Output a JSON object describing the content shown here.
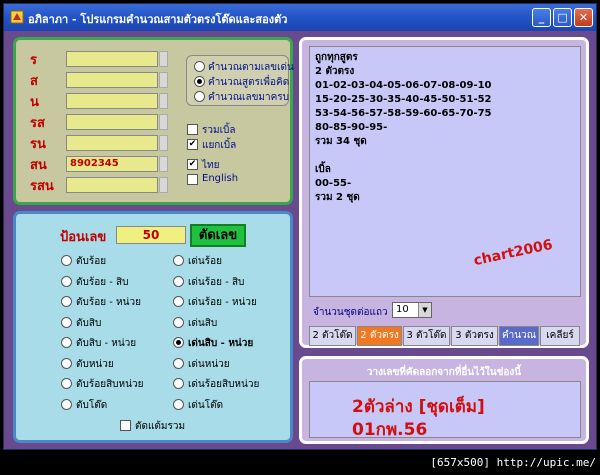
{
  "window": {
    "title": "อภิลาภา - โปรแกรมคำนวณสามตัวตรงโต๊ดและสองตัว"
  },
  "numbers": {
    "fields": [
      {
        "label": "ร",
        "value": ""
      },
      {
        "label": "ส",
        "value": ""
      },
      {
        "label": "น",
        "value": ""
      },
      {
        "label": "รส",
        "value": ""
      },
      {
        "label": "รน",
        "value": ""
      },
      {
        "label": "สน",
        "value": "8902345"
      },
      {
        "label": "รสน",
        "value": ""
      }
    ],
    "calc_modes": [
      {
        "label": "คำนวณตามเลขเด่น",
        "selected": false
      },
      {
        "label": "คำนวณสูตรเพื่อคิด",
        "selected": true
      },
      {
        "label": "คำนวณเลขมาครบ",
        "selected": false
      }
    ],
    "options": [
      {
        "label": "รวมเบิ้ล",
        "checked": false
      },
      {
        "label": "แยกเบิ้ล",
        "checked": true
      }
    ],
    "languages": [
      {
        "label": "ไทย",
        "checked": true
      },
      {
        "label": "English",
        "checked": false
      }
    ]
  },
  "cut": {
    "input_label": "ป้อนเลข",
    "input_value": "50",
    "button_label": "ตัดเลข",
    "left_options": [
      "ตับร้อย",
      "ตับร้อย - สิบ",
      "ตับร้อย - หน่วย",
      "ตับสิบ",
      "ตับสิบ - หน่วย",
      "ตับหน่วย",
      "ตับร้อยสิบหน่วย",
      "ตับโต๊ด"
    ],
    "right_options": [
      "เด่นร้อย",
      "เด่นร้อย - สิบ",
      "เด่นร้อย - หน่วย",
      "เด่นสิบ",
      "เด่นสิบ - หน่วย",
      "เด่นหน่วย",
      "เด่นร้อยสิบหน่วย",
      "เด่นโต๊ด"
    ],
    "selected_right": 4,
    "extra_label": "ตัดแต้มรวม"
  },
  "result": {
    "lines": [
      "ถูกทุกสูตร",
      "2 ตัวตรง",
      "01-02-03-04-05-06-07-08-09-10",
      "15-20-25-30-35-40-45-50-51-52",
      "53-54-56-57-58-59-60-65-70-75",
      "80-85-90-95-",
      "รวม 34 ชุด",
      "",
      "เบิ้ล",
      "00-55-",
      "รวม 2 ชุด"
    ],
    "watermark": "chart2006",
    "per_row_label": "จำนวนชุดต่อแถว",
    "per_row_value": "10",
    "tabs": [
      "2 ตัวโต๊ด",
      "2 ตัวตรง",
      "3 ตัวโต๊ด",
      "3 ตัวตรง",
      "คำนวณ",
      "เคลียร์"
    ]
  },
  "paste": {
    "header": "วางเลขที่คัดลอกจากที่อื่นไว้ในช่องนี้",
    "line1": "2ตัวล่าง [ชุดเต็ม]",
    "line2": "01กพ.56"
  },
  "footer": "[657x500] http://upic.me/"
}
